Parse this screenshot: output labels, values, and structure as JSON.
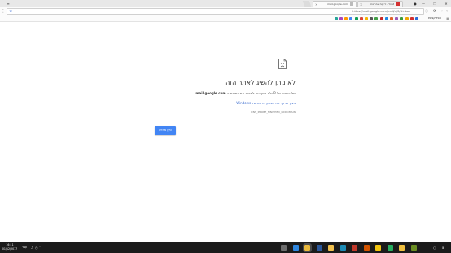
{
  "tabs": [
    {
      "title": "mail.google.com",
      "active": true
    },
    {
      "title": "Ynet - ידיעות אחרונות",
      "active": false
    }
  ],
  "window_controls": {
    "minimize": "—",
    "maximize": "❐",
    "close": "✕"
  },
  "address_bar": {
    "url": "https://mail.google.com/mail/u/0/#inbox",
    "back": "←",
    "forward": "→",
    "reload": "⟳",
    "star": "★"
  },
  "bookmarks": {
    "label": "אפליקציות",
    "icon_colors": [
      "#2b6cd8",
      "#d23030",
      "#f0a500",
      "#3a9a3a",
      "#9b59b6",
      "#e0602a",
      "#1e88e5",
      "#c62828",
      "#43a047",
      "#555555",
      "#f4b400",
      "#db4437",
      "#0f9d58",
      "#4285f4",
      "#ff9800",
      "#ab47bc",
      "#26a69a"
    ]
  },
  "error_page": {
    "title": "לא ניתן להשיג לאתר הזה",
    "description_prefix": "לא ניתן היה למצוא את כתובת ה-IP של השרת של",
    "host": "mail.google.com",
    "link": "בצע לניקוי את אבחון הרשת של Windows",
    "code": "DNS_PROBE_FINISHED_NXDOMAIN",
    "reload_button": "טען מחדש",
    "accent": "#4285f4"
  },
  "taskbar": {
    "time": "16:11",
    "date": "01/12/2017",
    "language": "עבר",
    "tray_icons": [
      "speaker-icon",
      "network-icon",
      "up-arrow-icon"
    ],
    "apps": [
      {
        "name": "task-view-icon",
        "color": "#6d6d6d"
      },
      {
        "name": "edge-icon",
        "color": "#2e86de"
      },
      {
        "name": "chrome-icon",
        "color": "#e8b83b"
      },
      {
        "name": "word-icon",
        "color": "#2b579a"
      },
      {
        "name": "explorer-icon",
        "color": "#f2c14e"
      },
      {
        "name": "photoshop-icon",
        "color": "#1d8bb5"
      },
      {
        "name": "app-red-icon",
        "color": "#c0392b"
      },
      {
        "name": "media-icon",
        "color": "#d35400"
      },
      {
        "name": "lightning-icon",
        "color": "#f1c40f"
      },
      {
        "name": "app-green-icon",
        "color": "#27ae60"
      },
      {
        "name": "folder-icon",
        "color": "#f0c040"
      },
      {
        "name": "mail-icon",
        "color": "#6b8e23"
      }
    ]
  }
}
